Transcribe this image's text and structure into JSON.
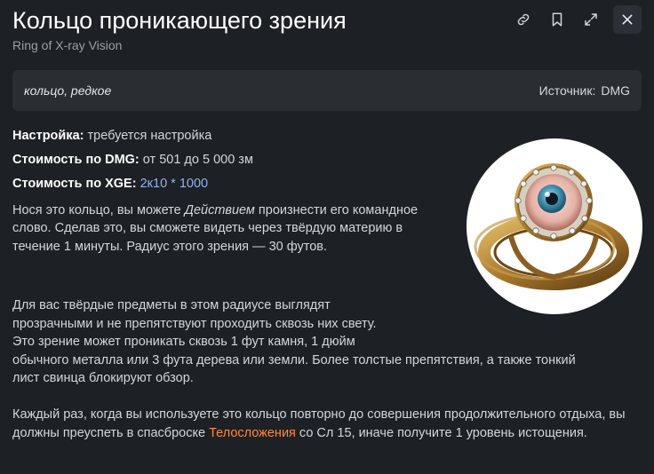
{
  "header": {
    "title": "Кольцо проникающего зрения",
    "subtitle": "Ring of X-ray Vision"
  },
  "toolbar": {
    "link_icon": "link-icon",
    "bookmark_icon": "bookmark-icon",
    "expand_icon": "expand-icon",
    "close_icon": "close-icon"
  },
  "meta": {
    "type": "кольцо, редкое",
    "source_label": "Источник:",
    "source_value": "DMG"
  },
  "properties": {
    "attunement_label": "Настройка:",
    "attunement_value": "требуется настройка",
    "cost_dmg_label": "Стоимость по DMG:",
    "cost_dmg_value": "от 501 до 5 000 зм",
    "cost_xge_label": "Стоимость по XGE:",
    "cost_xge_value": "2к10 * 1000"
  },
  "description": {
    "p1_before": "Нося это кольцо, вы можете ",
    "p1_italic": "Действием",
    "p1_after": " произнести его командное слово. Сделав это, вы сможете видеть через твёрдую материю в течение 1 минуты. Радиус этого зрения — 30 футов.",
    "p2_line1": "Для вас твёрдые предметы в этом радиусе выглядят",
    "p2_line2": "прозрачными и не препятствуют проходить сквозь них свету.",
    "p2_line3": "Это зрение может проникать сквозь 1 фут камня, 1 дюйм",
    "p2_line4": "обычного металла или 3 фута дерева или земли. Более толстые препятствия, а также тонкий",
    "p2_line5": "лист свинца блокируют обзор.",
    "p3_before": "Каждый раз, когда вы используете это кольцо повторно до совершения продолжительного отдыха, вы должны преуспеть в спасброске ",
    "p3_link": "Телосложения",
    "p3_after": " со Сл 15, иначе получите 1 уровень истощения."
  },
  "image": {
    "icon": "ring-eye-image"
  },
  "colors": {
    "background": "#1d2024",
    "meta_bar": "#2a2d32",
    "link_blue": "#8fb4f0",
    "link_orange": "#ff8a3d"
  }
}
